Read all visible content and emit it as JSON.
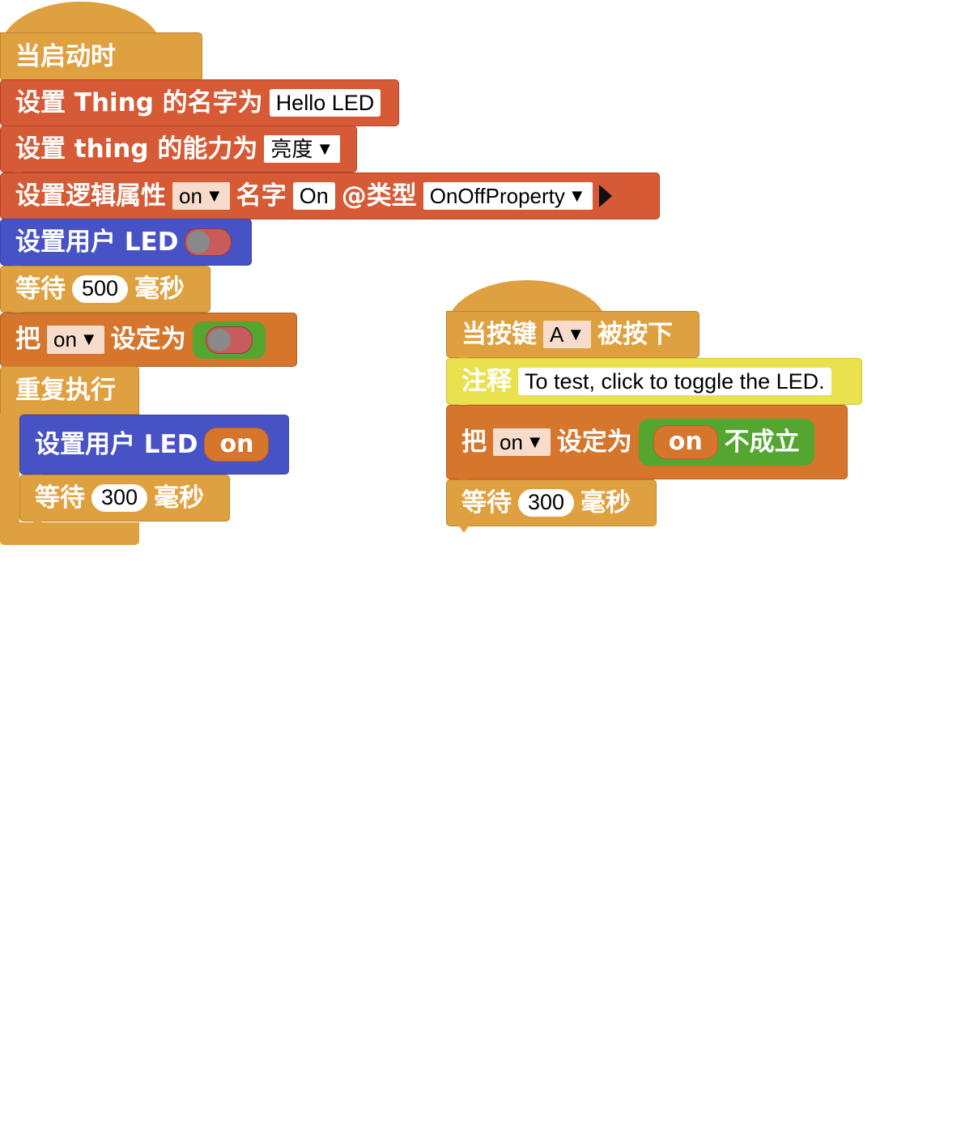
{
  "colors": {
    "events": "#DFA040",
    "things": "#D65A35",
    "led": "#4752C4",
    "vars": "#D6752C",
    "logic": "#55A630",
    "comment": "#EAE14E"
  },
  "left": {
    "hat_label": "当启动时",
    "set_name_label": "设置 Thing 的名字为",
    "set_name_value": "Hello LED",
    "set_capability_label": "设置 thing 的能力为",
    "set_capability_value": "亮度",
    "set_property_label": "设置逻辑属性",
    "set_property_var": "on",
    "set_property_name_label": "名字",
    "set_property_name_value": "On",
    "set_property_type_label": "@类型",
    "set_property_type_value": "OnOffProperty",
    "set_led_label": "设置用户 LED",
    "wait1_label": "等待",
    "wait1_value": "500",
    "wait1_unit": "毫秒",
    "assign_label": "把",
    "assign_var": "on",
    "assign_to_label": "设定为",
    "loop_label": "重复执行",
    "loop_set_led_label": "设置用户 LED",
    "loop_set_led_value": "on",
    "loop_wait_label": "等待",
    "loop_wait_value": "300",
    "loop_wait_unit": "毫秒"
  },
  "right": {
    "hat_label_pre": "当按键",
    "hat_key": "A",
    "hat_label_post": "被按下",
    "comment_label": "注释",
    "comment_text": "To test, click to toggle the LED.",
    "assign_label": "把",
    "assign_var": "on",
    "assign_to_label": "设定为",
    "not_var": "on",
    "not_label": "不成立",
    "wait_label": "等待",
    "wait_value": "300",
    "wait_unit": "毫秒"
  }
}
